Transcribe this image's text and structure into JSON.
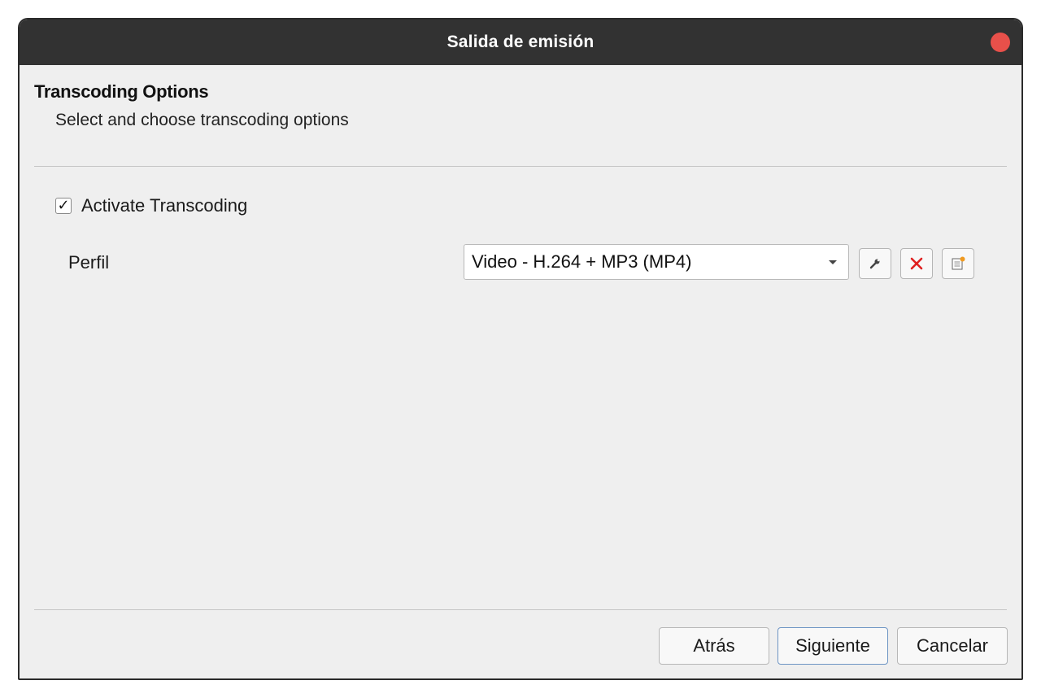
{
  "window": {
    "title": "Salida de emisión"
  },
  "page": {
    "heading": "Transcoding Options",
    "subheading": "Select and choose transcoding options"
  },
  "transcoding": {
    "checkbox_label": "Activate Transcoding",
    "checked": true,
    "check_mark": "✓"
  },
  "profile": {
    "label": "Perfil",
    "selected": "Video - H.264 + MP3 (MP4)"
  },
  "profile_tools": {
    "edit_icon": "wrench-icon",
    "delete_icon": "close-x-icon",
    "new_icon": "new-profile-icon",
    "delete_color": "#e02020",
    "new_accent": "#f09a20"
  },
  "buttons": {
    "back": "Atrás",
    "next": "Siguiente",
    "cancel": "Cancelar"
  },
  "colors": {
    "titlebar": "#323232",
    "close": "#e8504a",
    "window_bg": "#efefef",
    "default_button_border": "#6e95c4"
  }
}
